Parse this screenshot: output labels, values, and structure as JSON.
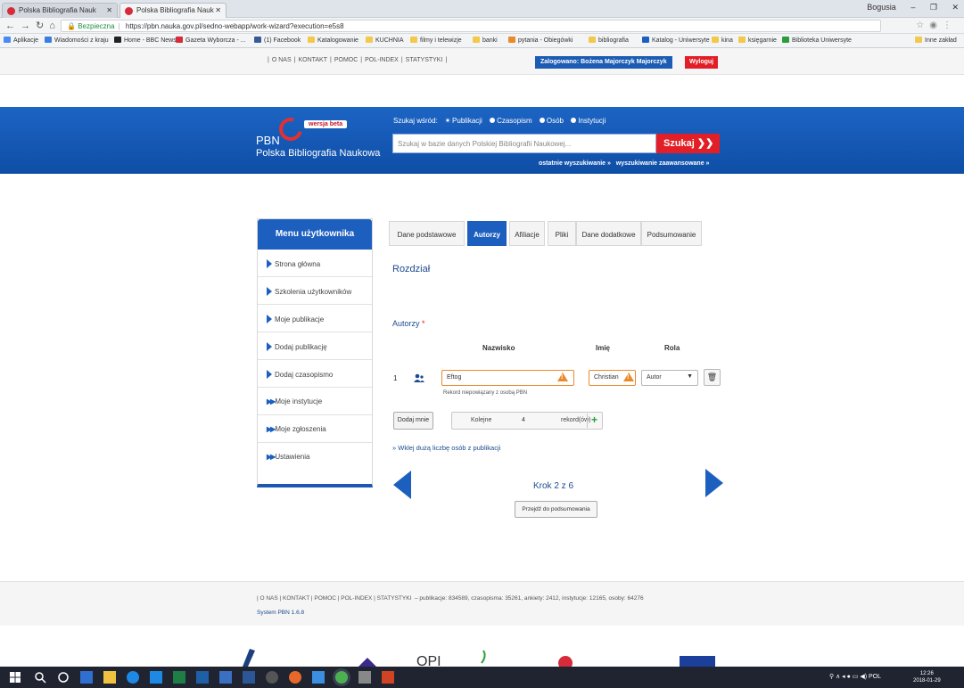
{
  "browser": {
    "tabs": [
      {
        "title": "Polska Bibliografia Nauk"
      },
      {
        "title": "Polska Bibliografia Nauk"
      }
    ],
    "window_user": "Bogusia",
    "secure_label": "Bezpieczna",
    "url": "https://pbn.nauka.gov.pl/sedno-webapp/work-wizard?execution=e5s8",
    "bookmarks": [
      "Aplikacje",
      "Wiadomości z kraju",
      "Home - BBC News",
      "Gazeta Wyborcza - ...",
      "(1) Facebook",
      "Katalogowanie",
      "KUCHNIA",
      "filmy i telewizje",
      "banki",
      "pytania - Obiegówki",
      "bibliografia",
      "Katalog - Uniwersyte",
      "kina",
      "księgarnie",
      "Biblioteka Uniwersyte"
    ],
    "bookmarks_more": "Inne zakład"
  },
  "topnav": {
    "links": [
      "O NAS",
      "KONTAKT",
      "POMOC",
      "POL-INDEX",
      "STATYSTYKI"
    ],
    "logged_in": "Zalogowano: Bożena Majorczyk Majorczyk",
    "logout": "Wyloguj"
  },
  "banner": {
    "logo": "PBN",
    "beta": "wersja beta",
    "name": "Polska Bibliografia Naukowa",
    "search_among": "Szukaj wśród:",
    "search_options": [
      "Publikacji",
      "Czasopism",
      "Osób",
      "Instytucji"
    ],
    "search_placeholder": "Szukaj w bazie danych Polskiej Bibliografii Naukowej...",
    "search_button": "Szukaj",
    "recent_searches": "ostatnie wyszukiwanie »",
    "advanced_search": "wyszukiwanie zaawansowane »"
  },
  "sidebar": {
    "title": "Menu użytkownika",
    "items": [
      {
        "label": "Strona główna"
      },
      {
        "label": "Szkolenia użytkowników"
      },
      {
        "label": "Moje publikacje"
      },
      {
        "label": "Dodaj publikację"
      },
      {
        "label": "Dodaj czasopismo"
      },
      {
        "label": "Moje instytucje"
      },
      {
        "label": "Moje zgłoszenia"
      },
      {
        "label": "Ustawienia"
      }
    ]
  },
  "wizard": {
    "tabs": [
      "Dane podstawowe",
      "Autorzy",
      "Afiliacje",
      "Pliki",
      "Dane dodatkowe",
      "Podsumowanie"
    ],
    "active_tab": "Autorzy",
    "section_title": "Rozdział",
    "authors_label": "Autorzy",
    "required_mark": "*",
    "columns": {
      "surname": "Nazwisko",
      "first_name": "Imię",
      "role": "Rola"
    },
    "authors": [
      {
        "num": "1",
        "surname": "Eftog",
        "first_name": "Christian",
        "role": "Autor",
        "note": "Rekord niepowiązany z osobą PBN"
      }
    ],
    "add_me": "Dodaj mnie",
    "count_prefix": "Kolejne",
    "count_value": "4",
    "count_suffix": "rekord(ów)",
    "add_symbol": "+",
    "bulk_link": "» Wklej dużą liczbę osób z publikacji",
    "step": "Krok 2 z 6",
    "summary_button": "Przejdź do podsumowania"
  },
  "footer": {
    "links": "| O NAS | KONTAKT | POMOC | POL-INDEX | STATYSTYKI",
    "stats": "– publikacje: 834589, czasopisma: 35261, ankiety: 2412, instytucje: 12165, osoby: 64276",
    "version": "System PBN 1.6.8"
  },
  "taskbar": {
    "language": "POL",
    "time": "12:26",
    "date": "2018-01-29"
  }
}
